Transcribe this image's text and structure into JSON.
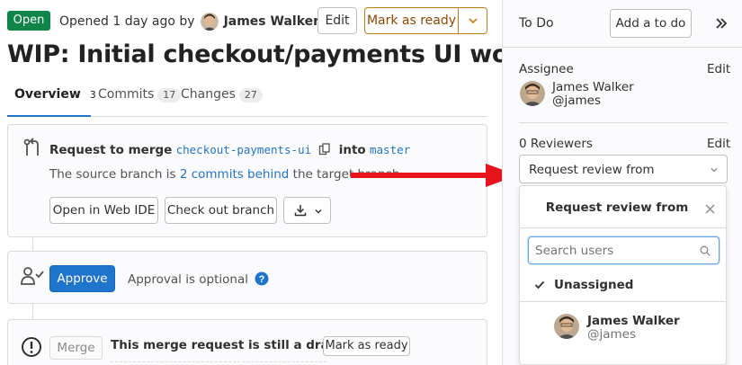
{
  "header": {
    "status_badge": "Open",
    "opened_text": "Opened 1 day ago by",
    "author_name": "James Walker",
    "edit_label": "Edit",
    "mark_ready_label": "Mark as ready"
  },
  "title": "WIP: Initial checkout/payments UI work",
  "tabs": [
    {
      "label": "Overview",
      "count": "3"
    },
    {
      "label": "Commits",
      "count": "17"
    },
    {
      "label": "Changes",
      "count": "27"
    }
  ],
  "merge_widget": {
    "request_prefix": "Request to merge",
    "source_branch": "checkout-payments-ui",
    "into_label": "into",
    "target_branch": "master",
    "behind_prefix": "The source branch is",
    "behind_link": "2 commits behind",
    "behind_suffix": "the target branch",
    "open_ide_label": "Open in Web IDE",
    "checkout_label": "Check out branch"
  },
  "approval": {
    "approve_label": "Approve",
    "optional_text": "Approval is optional"
  },
  "draft": {
    "merge_label": "Merge",
    "draft_text": "This merge request is still a draft.",
    "mark_ready_label": "Mark as ready"
  },
  "sidebar": {
    "todo_label": "To Do",
    "add_todo_label": "Add a to do",
    "assignee_label": "Assignee",
    "assignee_edit": "Edit",
    "assignee_name": "James Walker",
    "assignee_handle": "@james",
    "reviewers_label": "0 Reviewers",
    "reviewers_edit": "Edit",
    "request_review_label": "Request review from"
  },
  "review_dropdown": {
    "title": "Request review from",
    "search_placeholder": "Search users",
    "unassigned_label": "Unassigned",
    "user_name": "James Walker",
    "user_handle": "@james"
  },
  "colors": {
    "open_green": "#108548",
    "link_blue": "#1f75cb",
    "warning_orange": "#c17d10",
    "arrow_red": "#e8131b"
  }
}
